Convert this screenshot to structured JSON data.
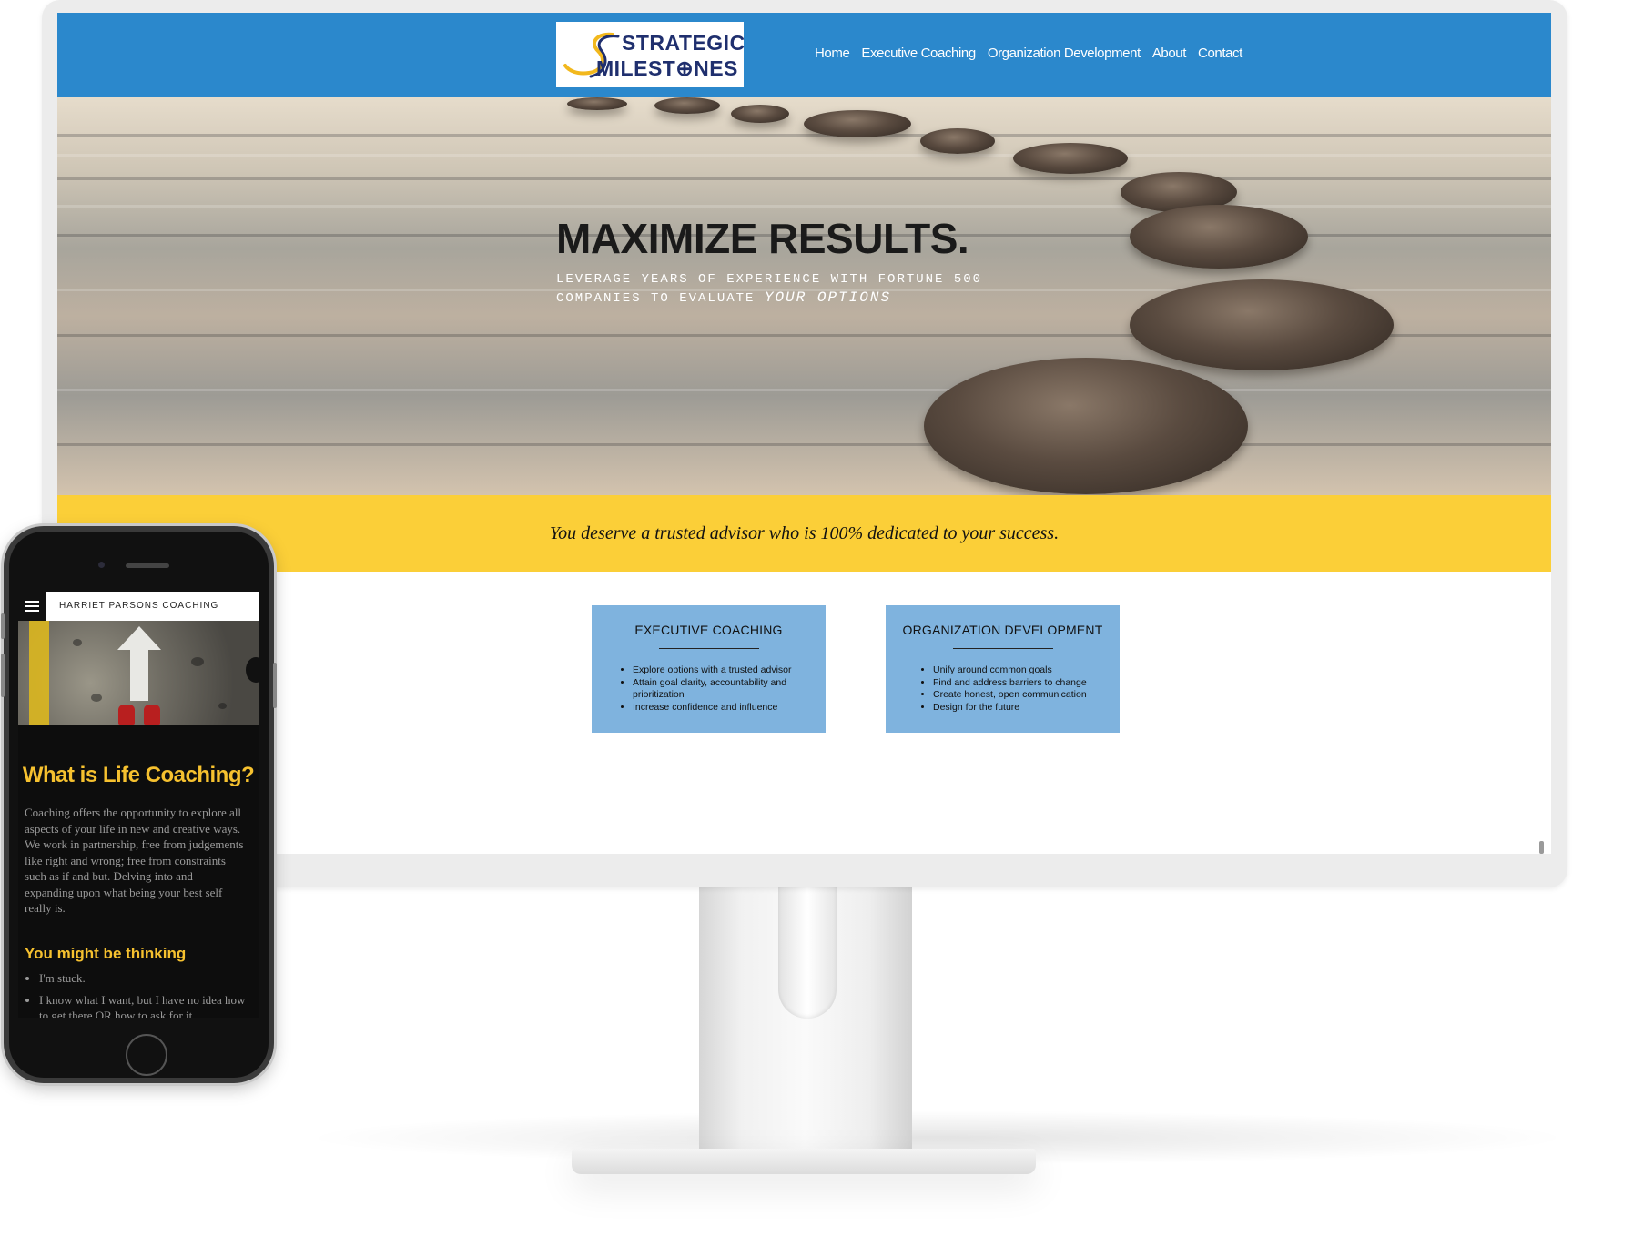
{
  "desktop": {
    "logo": {
      "line1": "STRATEGIC",
      "line2": "MILEST⊕NES"
    },
    "nav": [
      "Home",
      "Executive Coaching",
      "Organization Development",
      "About",
      "Contact"
    ],
    "hero": {
      "title": "MAXIMIZE RESULTS.",
      "subtitle_line1": "LEVERAGE YEARS OF EXPERIENCE WITH FORTUNE 500",
      "subtitle_line2_prefix": "COMPANIES TO EVALUATE",
      "subtitle_emphasis": "YOUR OPTIONS"
    },
    "tagline": "You deserve a trusted advisor who is 100% dedicated to your success.",
    "services": [
      {
        "title": "EXECUTIVE COACHING",
        "items": [
          "Explore options with a trusted advisor",
          "Attain goal clarity, accountability and prioritization",
          "Increase confidence and influence"
        ]
      },
      {
        "title": "ORGANIZATION DEVELOPMENT",
        "items": [
          "Unify around common goals",
          "Find and address barriers to change",
          "Create honest, open communication",
          "Design for the future"
        ]
      }
    ],
    "colors": {
      "header": "#2b88cc",
      "band": "#fbcf38",
      "card": "#7fb3de"
    }
  },
  "mobile": {
    "brand": "HARRIET PARSONS COACHING",
    "title": "What is Life Coaching?",
    "paragraph": "Coaching offers the opportunity to explore all aspects of your life in new and creative ways. We work in partnership, free from judgements like right and wrong; free from constraints such as if and but. Delving into and expanding upon what being your best self really is.",
    "subheading": "You might be thinking",
    "list": [
      "I'm stuck.",
      "I know what I want, but I have no idea how to get there OR how to ask for it."
    ],
    "colors": {
      "accent": "#f6c12f",
      "background": "#0d0d0d"
    },
    "icons": [
      "menu-icon"
    ]
  }
}
